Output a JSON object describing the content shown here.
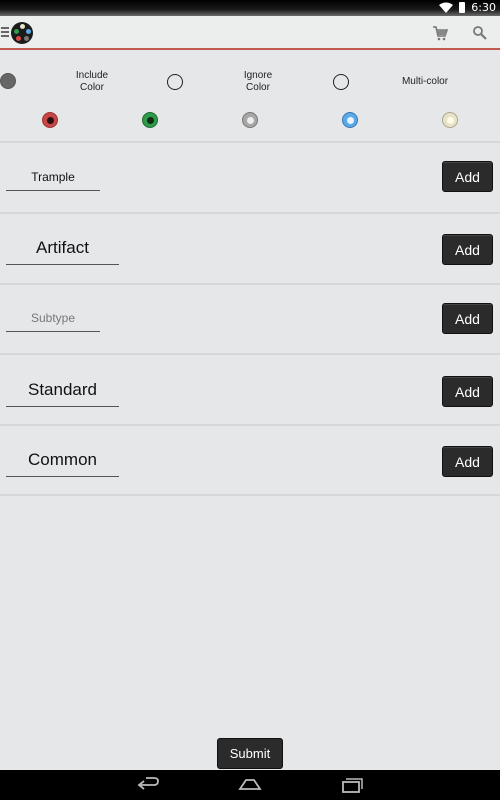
{
  "status": {
    "time": "6:30"
  },
  "filters": {
    "include_color": "Include\nColor",
    "ignore_color": "Ignore\nColor",
    "multi_color": "Multi-color",
    "selected": "include_color"
  },
  "mana_colors": [
    {
      "name": "red-mana-icon",
      "color": "#d94848"
    },
    {
      "name": "green-mana-icon",
      "color": "#2f9a4a"
    },
    {
      "name": "colorless-mana-icon",
      "color": "#a7a7a7"
    },
    {
      "name": "blue-mana-icon",
      "color": "#5aa9e8"
    },
    {
      "name": "white-mana-icon",
      "color": "#e7e3c8"
    }
  ],
  "entries": [
    {
      "value": "Trample",
      "button": "Add",
      "kind": "text"
    },
    {
      "value": "Artifact",
      "button": "Add",
      "kind": "large"
    },
    {
      "placeholder": "Subtype",
      "button": "Add",
      "kind": "placeholder"
    },
    {
      "value": "Standard",
      "button": "Add",
      "kind": "large"
    },
    {
      "value": "Common",
      "button": "Add",
      "kind": "large"
    }
  ],
  "submit": {
    "label": "Submit"
  },
  "accent": "#c25a52"
}
